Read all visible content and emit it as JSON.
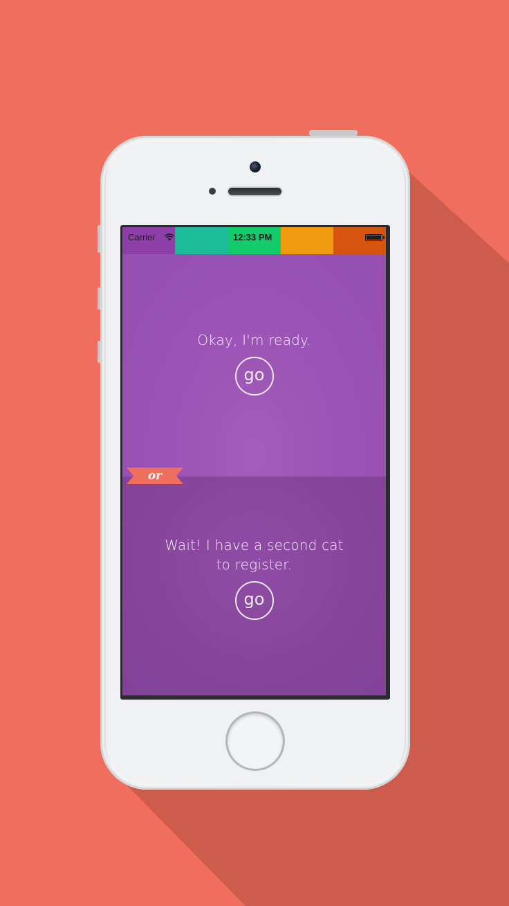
{
  "colors": {
    "background": "#ef6e5e",
    "long_shadow": "#cd5c4d",
    "accent_ribbon": "#ef6e5e",
    "status_segments": [
      "#8e3ea8",
      "#1cbc9a",
      "#12cb6b",
      "#f29a0d",
      "#d7540f"
    ]
  },
  "status_bar": {
    "carrier": "Carrier",
    "time": "12:33 PM",
    "signal_icon": "wifi-icon",
    "battery_icon": "battery-icon"
  },
  "main": {
    "top_prompt": "Okay, I'm ready.",
    "top_button": "go",
    "divider": "or",
    "bottom_prompt": "Wait! I have a second cat to register.",
    "bottom_button": "go"
  }
}
